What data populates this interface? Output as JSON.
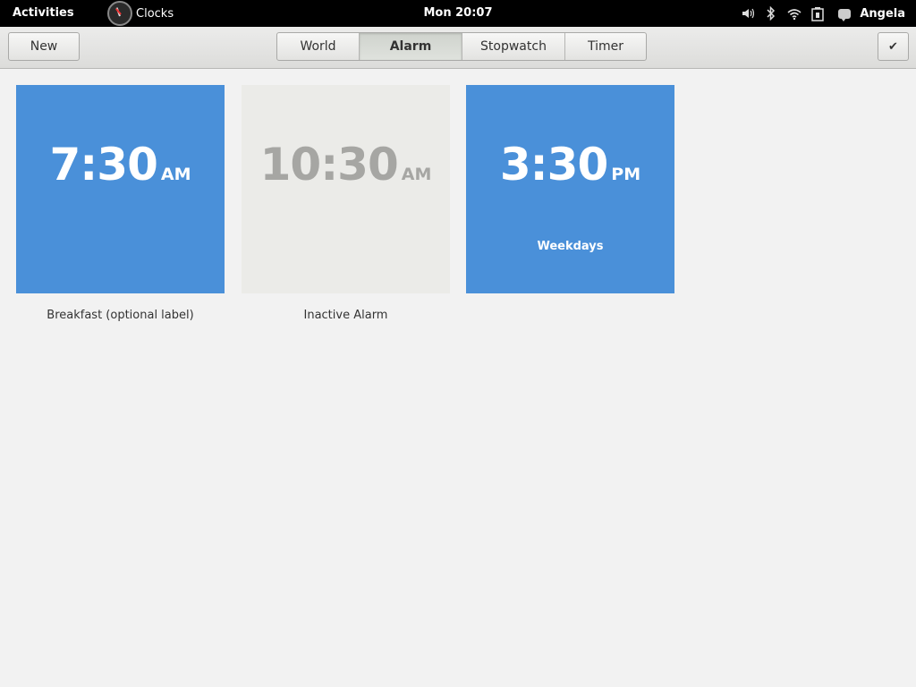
{
  "topbar": {
    "activities": "Activities",
    "app_name": "Clocks",
    "datetime": "Mon 20:07",
    "user": "Angela",
    "status_icons": [
      "volume-icon",
      "bluetooth-icon",
      "wifi-icon",
      "battery-icon"
    ]
  },
  "toolbar": {
    "new_label": "New",
    "done_icon": "✔",
    "tabs": [
      {
        "label": "World",
        "active": false
      },
      {
        "label": "Alarm",
        "active": true
      },
      {
        "label": "Stopwatch",
        "active": false
      },
      {
        "label": "Timer",
        "active": false
      }
    ]
  },
  "alarms": [
    {
      "time": "7:30",
      "period": "AM",
      "repeat": "",
      "label": "Breakfast (optional label)",
      "active": true
    },
    {
      "time": "10:30",
      "period": "AM",
      "repeat": "",
      "label": "Inactive Alarm",
      "active": false
    },
    {
      "time": "3:30",
      "period": "PM",
      "repeat": "Weekdays",
      "label": "",
      "active": true
    }
  ],
  "colors": {
    "active_tile": "#4a90d9",
    "inactive_tile": "#ebebe8",
    "inactive_text": "#a6a6a3"
  }
}
